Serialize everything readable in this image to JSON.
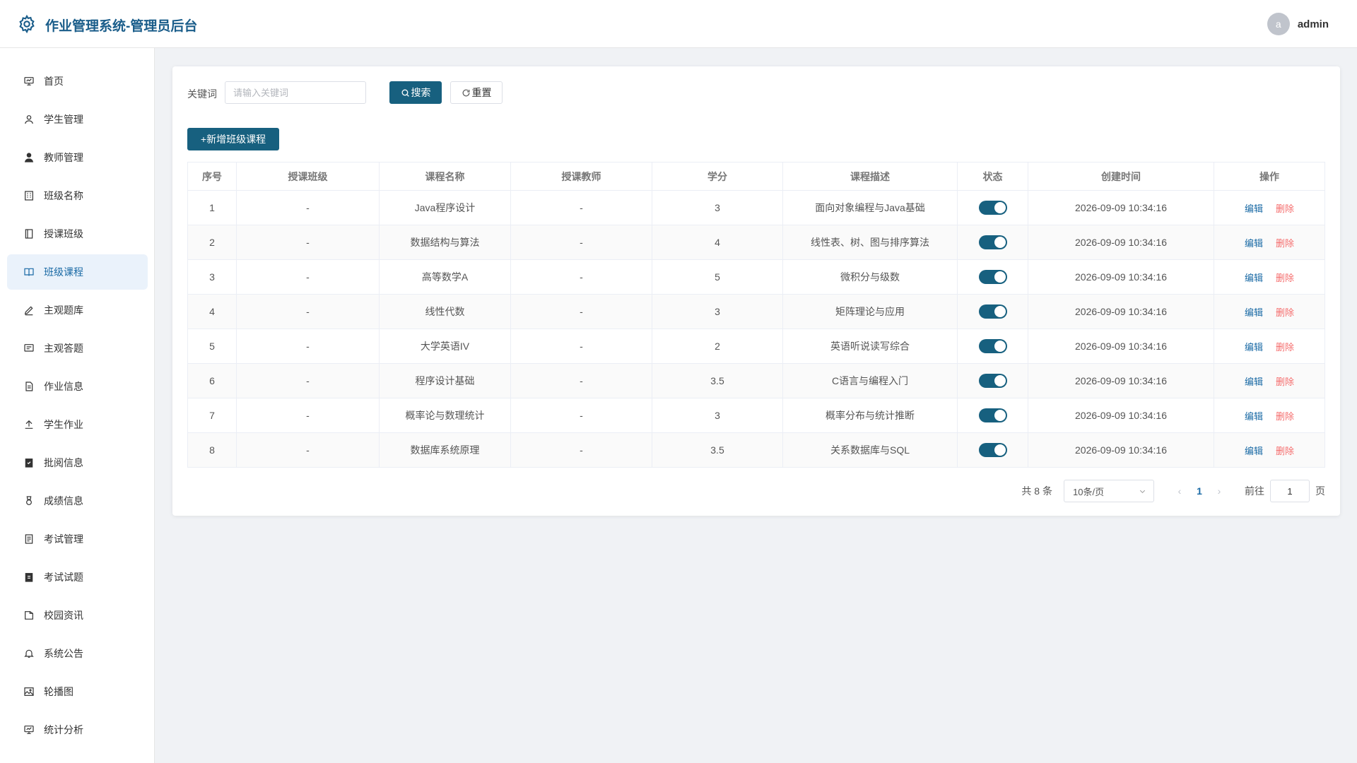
{
  "header": {
    "title": "作业管理系统-管理员后台",
    "avatar_letter": "a",
    "user_name": "admin"
  },
  "sidebar": {
    "items": [
      {
        "label": "首页",
        "icon": "dashboard-icon"
      },
      {
        "label": "学生管理",
        "icon": "user-icon"
      },
      {
        "label": "教师管理",
        "icon": "teacher-icon"
      },
      {
        "label": "班级名称",
        "icon": "building-icon"
      },
      {
        "label": "授课班级",
        "icon": "door-icon"
      },
      {
        "label": "班级课程",
        "icon": "book-icon",
        "active": true
      },
      {
        "label": "主观题库",
        "icon": "edit-pen-icon"
      },
      {
        "label": "主观答题",
        "icon": "chat-icon"
      },
      {
        "label": "作业信息",
        "icon": "document-icon"
      },
      {
        "label": "学生作业",
        "icon": "upload-icon"
      },
      {
        "label": "批阅信息",
        "icon": "checklist-icon"
      },
      {
        "label": "成绩信息",
        "icon": "medal-icon"
      },
      {
        "label": "考试管理",
        "icon": "tickets-icon"
      },
      {
        "label": "考试试题",
        "icon": "clipboard-icon"
      },
      {
        "label": "校园资讯",
        "icon": "news-icon"
      },
      {
        "label": "系统公告",
        "icon": "bell-icon"
      },
      {
        "label": "轮播图",
        "icon": "picture-icon"
      },
      {
        "label": "统计分析",
        "icon": "chart-icon"
      }
    ]
  },
  "search": {
    "label": "关键词",
    "placeholder": "请输入关键词",
    "search_label": "搜索",
    "reset_label": "重置"
  },
  "toolbar": {
    "add_label": "+新增班级课程"
  },
  "table": {
    "columns": [
      "序号",
      "授课班级",
      "课程名称",
      "授课教师",
      "学分",
      "课程描述",
      "状态",
      "创建时间",
      "操作"
    ],
    "edit_label": "编辑",
    "delete_label": "删除",
    "rows": [
      {
        "no": "1",
        "class": "-",
        "course": "Java程序设计",
        "teacher": "-",
        "credit": "3",
        "desc": "面向对象编程与Java基础",
        "status": true,
        "created": "2026-09-09 10:34:16"
      },
      {
        "no": "2",
        "class": "-",
        "course": "数据结构与算法",
        "teacher": "-",
        "credit": "4",
        "desc": "线性表、树、图与排序算法",
        "status": true,
        "created": "2026-09-09 10:34:16"
      },
      {
        "no": "3",
        "class": "-",
        "course": "高等数学A",
        "teacher": "-",
        "credit": "5",
        "desc": "微积分与级数",
        "status": true,
        "created": "2026-09-09 10:34:16"
      },
      {
        "no": "4",
        "class": "-",
        "course": "线性代数",
        "teacher": "-",
        "credit": "3",
        "desc": "矩阵理论与应用",
        "status": true,
        "created": "2026-09-09 10:34:16"
      },
      {
        "no": "5",
        "class": "-",
        "course": "大学英语IV",
        "teacher": "-",
        "credit": "2",
        "desc": "英语听说读写综合",
        "status": true,
        "created": "2026-09-09 10:34:16"
      },
      {
        "no": "6",
        "class": "-",
        "course": "程序设计基础",
        "teacher": "-",
        "credit": "3.5",
        "desc": "C语言与编程入门",
        "status": true,
        "created": "2026-09-09 10:34:16"
      },
      {
        "no": "7",
        "class": "-",
        "course": "概率论与数理统计",
        "teacher": "-",
        "credit": "3",
        "desc": "概率分布与统计推断",
        "status": true,
        "created": "2026-09-09 10:34:16"
      },
      {
        "no": "8",
        "class": "-",
        "course": "数据库系统原理",
        "teacher": "-",
        "credit": "3.5",
        "desc": "关系数据库与SQL",
        "status": true,
        "created": "2026-09-09 10:34:16"
      }
    ]
  },
  "pagination": {
    "total_text": "共 8 条",
    "page_size": "10条/页",
    "current_page": "1",
    "goto_label": "前往",
    "goto_value": "1",
    "page_suffix": "页"
  },
  "colors": {
    "primary": "#17607f",
    "link": "#1a6aa5",
    "danger": "#f56c6c",
    "active_bg": "#eaf2fb"
  }
}
